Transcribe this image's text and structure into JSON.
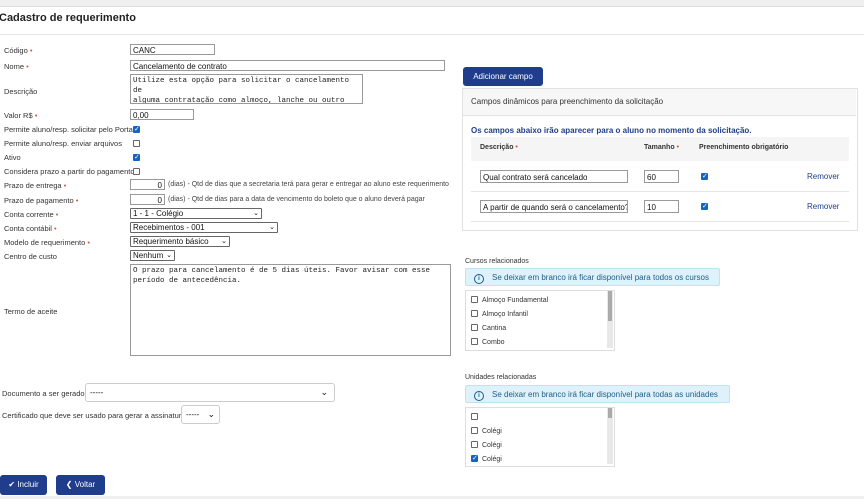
{
  "header": {
    "title": "Cadastro de requerimento"
  },
  "form": {
    "codigo": {
      "label": "Código",
      "value": "CANC"
    },
    "nome": {
      "label": "Nome",
      "value": "Cancelamento de contrato"
    },
    "descricao": {
      "label": "Descrição",
      "value": "Utilize esta opção para solicitar o cancelamento de\nalguma contratação como almoço, lanche ou outro"
    },
    "valor": {
      "label": "Valor R$",
      "value": "0,00"
    },
    "permite_portal": {
      "label": "Permite aluno/resp. solicitar pelo Portal",
      "checked": true
    },
    "permite_arquivos": {
      "label": "Permite aluno/resp. enviar arquivos",
      "checked": false
    },
    "ativo": {
      "label": "Ativo",
      "checked": true
    },
    "considera_prazo": {
      "label": "Considera prazo a partir do pagamento",
      "checked": false
    },
    "prazo_entrega": {
      "label": "Prazo de entrega",
      "value": "0",
      "hint": "(dias) - Qtd de dias que a secretaria terá para gerar e entregar ao aluno este requerimento"
    },
    "prazo_pagamento": {
      "label": "Prazo de pagamento",
      "value": "0",
      "hint": "(dias) - Qtd de dias para a data de vencimento do boleto que o aluno deverá pagar"
    },
    "conta_corrente": {
      "label": "Conta corrente",
      "value": "1 - 1 - Colégio"
    },
    "conta_contabil": {
      "label": "Conta contábil",
      "value": "Recebimentos - 001"
    },
    "modelo": {
      "label": "Modelo de requerimento",
      "value": "Requerimento básico"
    },
    "centro_custo": {
      "label": "Centro de custo",
      "value": "Nenhum"
    },
    "termo": {
      "label": "Termo de aceite",
      "value": "O prazo para cancelamento é de 5 dias úteis. Favor avisar com esse\nperíodo de antecedência."
    },
    "documento": {
      "label": "Documento a ser gerado",
      "value": "-----"
    },
    "certificado": {
      "label": "Certificado que deve ser usado para gerar a assinatura",
      "value": "-----"
    }
  },
  "dynamic": {
    "add_button": "Adicionar campo",
    "panel_title": "Campos dinâmicos para preenchimento da solicitação",
    "subtitle": "Os campos abaixo irão aparecer para o aluno no momento da solicitação.",
    "headers": {
      "descricao": "Descrição",
      "tamanho": "Tamanho",
      "obrigatorio": "Preenchimento obrigatório"
    },
    "rows": [
      {
        "descricao": "Qual contrato será cancelado",
        "tamanho": "60",
        "obrigatorio": true,
        "remove": "Remover"
      },
      {
        "descricao": "A partir de quando será o cancelamento?",
        "tamanho": "10",
        "obrigatorio": true,
        "remove": "Remover"
      }
    ]
  },
  "cursos": {
    "label": "Cursos relacionados",
    "info": "Se deixar em branco irá ficar disponível para todos os cursos",
    "items": [
      "Almoço Fundamental",
      "Almoço Infantil",
      "Cantina",
      "Combo"
    ]
  },
  "unidades": {
    "label": "Unidades relacionadas",
    "info": "Se deixar em branco irá ficar disponível para todas as unidades",
    "items": [
      {
        "label": "",
        "checked": false
      },
      {
        "label": "Colégi",
        "checked": false
      },
      {
        "label": "Colégi",
        "checked": false
      },
      {
        "label": "Colégi",
        "checked": true
      }
    ]
  },
  "footer": {
    "incluir": "Incluir",
    "voltar": "Voltar"
  },
  "colors": {
    "primary": "#1f3d8c",
    "checkbox": "#1565c0",
    "info_bg": "#dff1fb",
    "required": "#d9534f"
  }
}
